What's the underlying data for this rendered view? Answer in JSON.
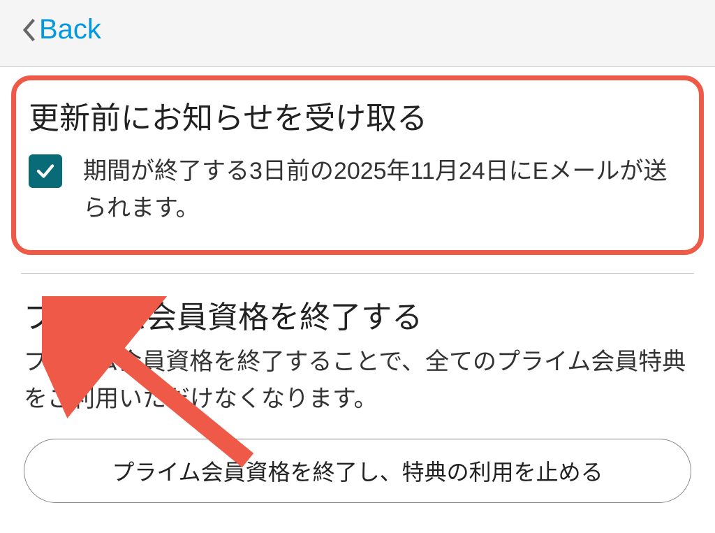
{
  "header": {
    "back_label": "Back"
  },
  "notify_section": {
    "title": "更新前にお知らせを受け取る",
    "checkbox_label": "期間が終了する3日前の2025年11月24日にEメールが送られます。"
  },
  "terminate_section": {
    "title": "プライム会員資格を終了する",
    "description": "プライム会員資格を終了することで、全てのプライム会員特典をご利用いただけなくなります。",
    "button_label": "プライム会員資格を終了し、特典の利用を止める"
  },
  "annotation": {
    "highlight_color": "#ee5a47"
  }
}
